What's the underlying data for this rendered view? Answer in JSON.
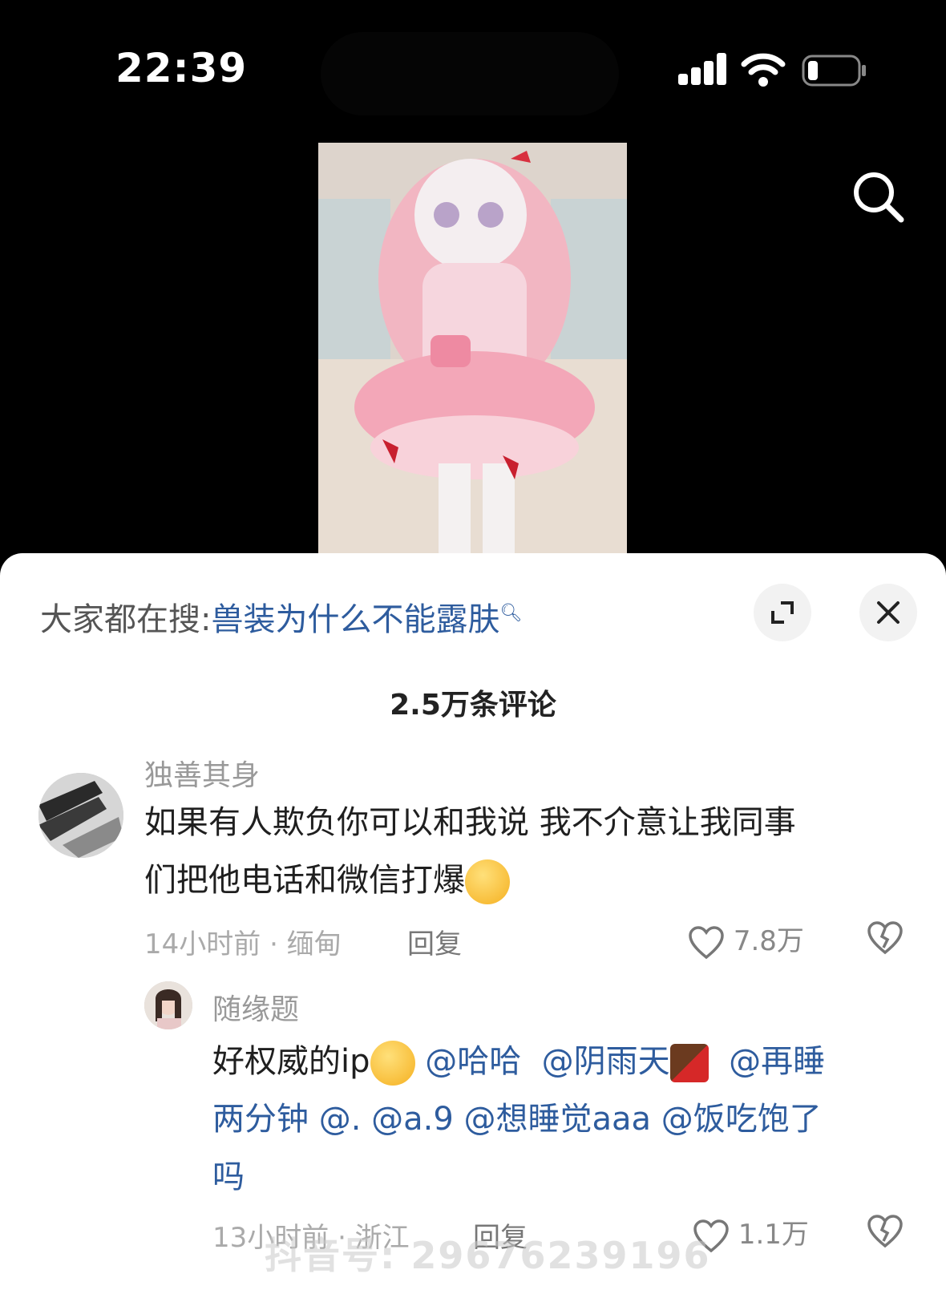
{
  "status_bar": {
    "time": "22:39"
  },
  "video": {
    "search_icon": "search-icon"
  },
  "sheet": {
    "hot_search_prefix": "大家都在搜:",
    "hot_search_term": "兽装为什么不能露肤",
    "comment_count": "2.5万条评论"
  },
  "comments": [
    {
      "username": "独善其身",
      "text_a": "如果有人欺负你可以和我说 我不介意让我同事",
      "text_b": "们把他电话和微信打爆",
      "time_location": "14小时前 · 缅甸",
      "reply_label": "回复",
      "likes": "7.8万"
    },
    {
      "username": "随缘题",
      "text_a": "好权威的ip",
      "mention_1": "@哈哈",
      "mention_2": "@阴雨天",
      "mention_3": "@再睡",
      "line2": "两分钟 @. @a.9 @想睡觉aaa @饭吃饱了",
      "line3": "吗",
      "time_location": "13小时前 · 浙江",
      "reply_label": "回复",
      "likes": "1.1万"
    }
  ],
  "watermark": "抖音号: 29676239196"
}
